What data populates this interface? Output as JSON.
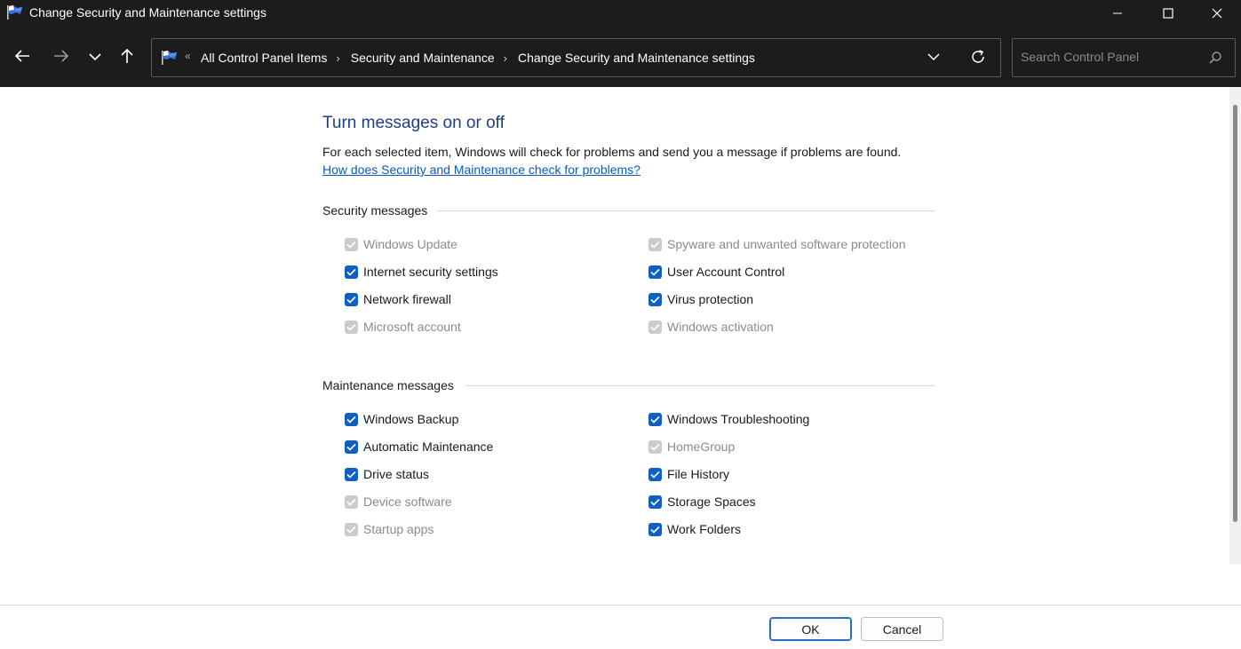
{
  "window": {
    "title": "Change Security and Maintenance settings",
    "app_icon": "flag-icon",
    "controls": [
      "minimize-icon",
      "maximize-icon",
      "close-icon"
    ]
  },
  "nav": {
    "back_icon": "arrow-left-icon",
    "forward_icon": "arrow-right-icon",
    "recent_icon": "chevron-down-icon",
    "up_icon": "arrow-up-icon",
    "overflow": "«",
    "breadcrumbs": [
      "All Control Panel Items",
      "Security and Maintenance",
      "Change Security and Maintenance settings"
    ],
    "breadcrumb_separator": "›",
    "search_placeholder": "Search Control Panel"
  },
  "main": {
    "heading": "Turn messages on or off",
    "description": "For each selected item, Windows will check for problems and send you a message if problems are found.",
    "help_link": "How does Security and Maintenance check for problems?"
  },
  "security": {
    "title": "Security messages",
    "items": [
      {
        "label": "Windows Update",
        "checked": true,
        "enabled": false
      },
      {
        "label": "Spyware and unwanted software protection",
        "checked": true,
        "enabled": false
      },
      {
        "label": "Internet security settings",
        "checked": true,
        "enabled": true
      },
      {
        "label": "User Account Control",
        "checked": true,
        "enabled": true
      },
      {
        "label": "Network firewall",
        "checked": true,
        "enabled": true
      },
      {
        "label": "Virus protection",
        "checked": true,
        "enabled": true
      },
      {
        "label": "Microsoft account",
        "checked": true,
        "enabled": false
      },
      {
        "label": "Windows activation",
        "checked": true,
        "enabled": false
      }
    ]
  },
  "maintenance": {
    "title": "Maintenance messages",
    "items": [
      {
        "label": "Windows Backup",
        "checked": true,
        "enabled": true
      },
      {
        "label": "Windows Troubleshooting",
        "checked": true,
        "enabled": true
      },
      {
        "label": "Automatic Maintenance",
        "checked": true,
        "enabled": true
      },
      {
        "label": "HomeGroup",
        "checked": true,
        "enabled": false
      },
      {
        "label": "Drive status",
        "checked": true,
        "enabled": true
      },
      {
        "label": "File History",
        "checked": true,
        "enabled": true
      },
      {
        "label": "Device software",
        "checked": true,
        "enabled": false
      },
      {
        "label": "Storage Spaces",
        "checked": true,
        "enabled": true
      },
      {
        "label": "Startup apps",
        "checked": true,
        "enabled": false
      },
      {
        "label": "Work Folders",
        "checked": true,
        "enabled": true
      }
    ]
  },
  "footer": {
    "ok_label": "OK",
    "cancel_label": "Cancel"
  },
  "colors": {
    "accent": "#0f5fc4",
    "heading": "#1e3f86",
    "link": "#0a5bc4",
    "titlebar": "#1c1c1c",
    "disabled_box": "#cbcbcb",
    "disabled_text": "#8b8b8b"
  }
}
